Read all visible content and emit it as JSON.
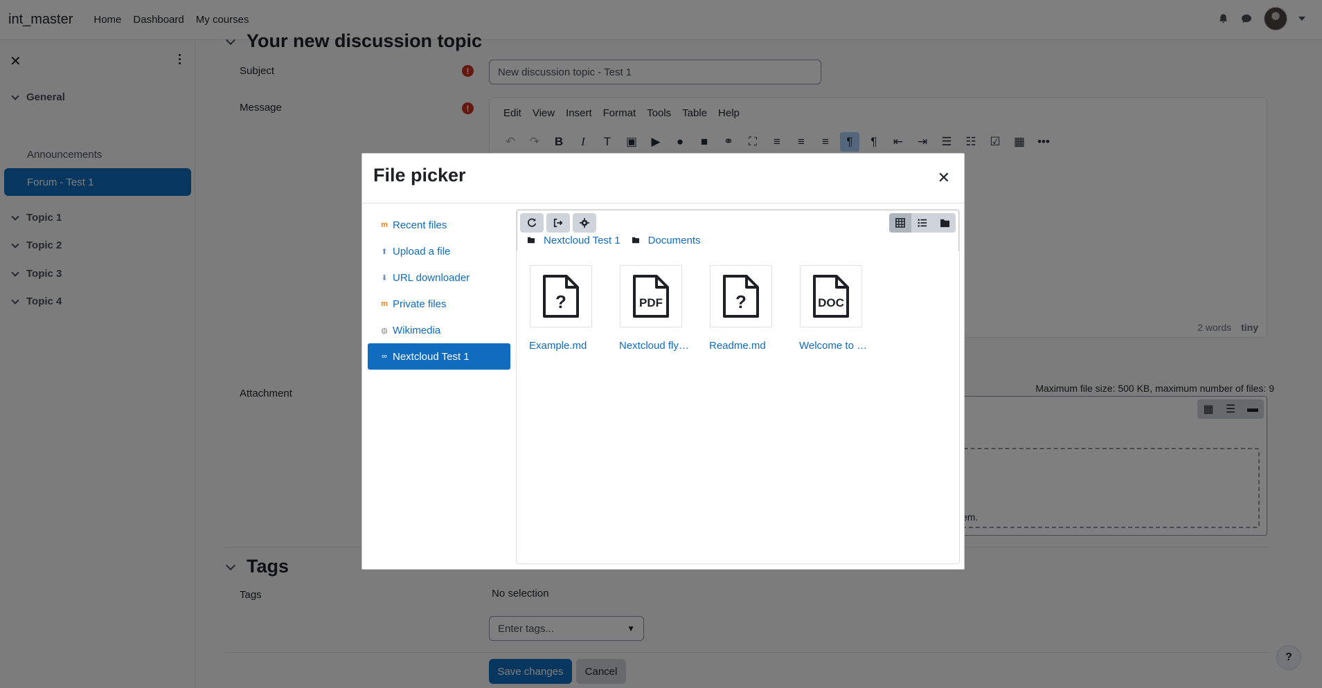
{
  "navbar": {
    "brand": "int_master",
    "links": [
      "Home",
      "Dashboard",
      "My courses"
    ]
  },
  "drawer": {
    "sections": [
      {
        "label": "General"
      },
      {
        "label": "Topic 1"
      },
      {
        "label": "Topic 2"
      },
      {
        "label": "Topic 3"
      },
      {
        "label": "Topic 4"
      }
    ],
    "items": [
      {
        "label": "Announcements"
      },
      {
        "label": "Forum - Test 1",
        "active": true
      }
    ]
  },
  "form": {
    "section_title": "Your new discussion topic",
    "subject_label": "Subject",
    "subject_value": "New discussion topic - Test 1",
    "message_label": "Message",
    "editor_menu": [
      "Edit",
      "View",
      "Insert",
      "Format",
      "Tools",
      "Table",
      "Help"
    ],
    "word_count": "2 words",
    "editor_brand": "tiny",
    "attachment_label": "Attachment",
    "max_size_text": "Maximum file size: 500 KB, maximum number of files: 9",
    "drop_text_fragment": "em.",
    "tags_section_title": "Tags",
    "tags_label": "Tags",
    "tags_selection": "No selection",
    "tags_placeholder": "Enter tags...",
    "save_label": "Save changes",
    "cancel_label": "Cancel",
    "help_label": "?"
  },
  "file_picker": {
    "title": "File picker",
    "repositories": [
      {
        "label": "Recent files",
        "icon": "moodle-icon"
      },
      {
        "label": "Upload a file",
        "icon": "upload-icon"
      },
      {
        "label": "URL downloader",
        "icon": "url-icon"
      },
      {
        "label": "Private files",
        "icon": "moodle-icon"
      },
      {
        "label": "Wikimedia",
        "icon": "wikimedia-icon"
      },
      {
        "label": "Nextcloud Test 1",
        "icon": "nextcloud-icon",
        "active": true
      }
    ],
    "path": [
      "Nextcloud Test 1",
      "Documents"
    ],
    "files": [
      {
        "name": "Example.md",
        "icon": "unknown-file-icon",
        "badge": "?"
      },
      {
        "name": "Nextcloud flyer.pdf",
        "display": "Nextcloud fly…",
        "icon": "pdf-file-icon",
        "badge": "PDF"
      },
      {
        "name": "Readme.md",
        "icon": "unknown-file-icon",
        "badge": "?"
      },
      {
        "name": "Welcome to Nextcloud Hub.docx",
        "display": "Welcome to …",
        "icon": "doc-file-icon",
        "badge": "DOC"
      }
    ]
  },
  "colors": {
    "primary": "#0f6cbf",
    "required": "#ca3120",
    "backdrop": "rgba(0,0,0,0.5)"
  }
}
